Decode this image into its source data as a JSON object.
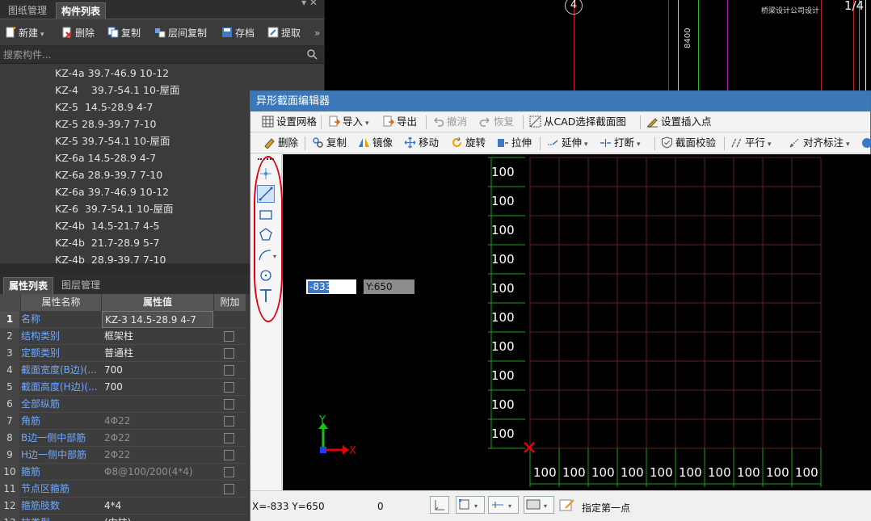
{
  "left_panel": {
    "top_tabs": [
      "图纸管理",
      "构件列表"
    ],
    "toolbar": {
      "new": "新建",
      "delete": "删除",
      "copy": "复制",
      "floor_copy": "层间复制",
      "archive": "存档",
      "extract": "提取"
    },
    "search_placeholder": "搜索构件...",
    "components": [
      "KZ-4a 39.7-46.9 10-12",
      "KZ-4    39.7-54.1 10-屋面",
      "KZ-5  14.5-28.9 4-7",
      "KZ-5 28.9-39.7 7-10",
      "KZ-5 39.7-54.1 10-屋面",
      "KZ-6a 14.5-28.9 4-7",
      "KZ-6a 28.9-39.7 7-10",
      "KZ-6a 39.7-46.9 10-12",
      "KZ-6  39.7-54.1 10-屋面",
      "KZ-4b  14.5-21.7 4-5",
      "KZ-4b  21.7-28.9 5-7",
      "KZ-4b  28.9-39.7 7-10"
    ],
    "prop_tabs": [
      "属性列表",
      "图层管理"
    ],
    "prop_headers": [
      "属性名称",
      "属性值",
      "附加"
    ],
    "properties": [
      {
        "num": "1",
        "name": "名称",
        "value": "KZ-3  14.5-28.9 4-7"
      },
      {
        "num": "2",
        "name": "结构类别",
        "value": "框架柱"
      },
      {
        "num": "3",
        "name": "定额类别",
        "value": "普通柱"
      },
      {
        "num": "4",
        "name": "截面宽度(B边)(...",
        "value": "700"
      },
      {
        "num": "5",
        "name": "截面高度(H边)(...",
        "value": "700"
      },
      {
        "num": "6",
        "name": "全部纵筋",
        "value": ""
      },
      {
        "num": "7",
        "name": "角筋",
        "value": "4Φ22"
      },
      {
        "num": "8",
        "name": "B边一侧中部筋",
        "value": "2Φ22"
      },
      {
        "num": "9",
        "name": "H边一侧中部筋",
        "value": "2Φ22"
      },
      {
        "num": "10",
        "name": "箍筋",
        "value": "Φ8@100/200(4*4)"
      },
      {
        "num": "11",
        "name": "节点区箍筋",
        "value": ""
      },
      {
        "num": "12",
        "name": "箍筋肢数",
        "value": "4*4"
      },
      {
        "num": "13",
        "name": "柱类型",
        "value": "(中柱)"
      }
    ]
  },
  "cad_background": {
    "axis_labels": [
      "4",
      "1/4"
    ],
    "dim_text": "8400",
    "note_text": "桥梁设计公司设计"
  },
  "editor": {
    "title": "异形截面编辑器",
    "toolbar1": {
      "grid": "设置网格",
      "import": "导入",
      "export": "导出",
      "undo": "撤消",
      "redo": "恢复",
      "from_cad": "从CAD选择截面图",
      "insert_point": "设置插入点"
    },
    "toolbar2": {
      "delete": "删除",
      "copy": "复制",
      "mirror": "镜像",
      "move": "移动",
      "rotate": "旋转",
      "stretch": "拉伸",
      "extend": "延伸",
      "break": "打断",
      "check": "截面校验",
      "parallel": "平行",
      "align_dim": "对齐标注"
    },
    "left_tools": [
      "point-icon",
      "line-icon",
      "rectangle-icon",
      "polygon-icon",
      "arc-icon",
      "circle-icon",
      "text-icon"
    ],
    "coord_input_x": "-833",
    "coord_input_y": "Y:650",
    "grid_row_labels": [
      "100",
      "100",
      "100",
      "100",
      "100",
      "100",
      "100",
      "100",
      "100",
      "100"
    ],
    "grid_col_labels": [
      "100",
      "100",
      "100",
      "100",
      "100",
      "100",
      "100",
      "100",
      "100",
      "100"
    ],
    "axis_x": "X",
    "axis_y": "Y",
    "status_coords": "X=-833 Y=650",
    "status_value": "0",
    "status_prompt": "指定第一点"
  },
  "colors": {
    "grid_line": "#5a2323",
    "dim_line": "#1ea01e",
    "annotation_red": "#e0000f",
    "title_blue": "#3c78b8"
  }
}
